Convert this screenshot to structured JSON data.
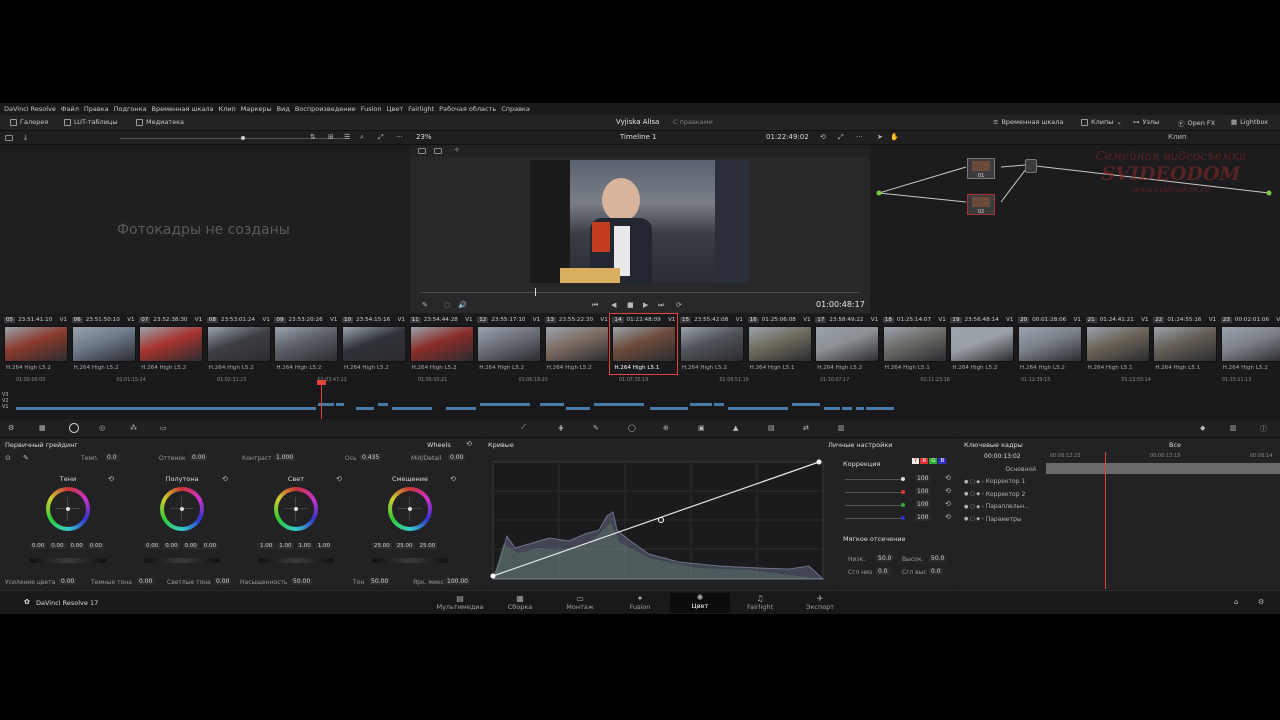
{
  "menu": [
    "DaVinci Resolve",
    "Файл",
    "Правка",
    "Подгонка",
    "Временная шкала",
    "Клип",
    "Маркеры",
    "Вид",
    "Воспроизведение",
    "Fusion",
    "Цвет",
    "Fairlight",
    "Рабочая область",
    "Справка"
  ],
  "toolbar": {
    "gallery": "Галерея",
    "luts": "LUT-таблицы",
    "media": "Медиатека",
    "project_title": "Vyjiska Alisa",
    "project_status": "С правками",
    "timeline_btn": "Временная шкала",
    "clips_btn": "Клипы",
    "nodes_btn": "Узлы",
    "openfx": "Open FX",
    "lightbox": "Lightbox"
  },
  "viewer": {
    "zoom": "23%",
    "timeline_name": "Timeline 1",
    "timecode_top": "01:22:49:02",
    "timecode": "01:00:48:17",
    "clip_mode": "Клип"
  },
  "gallery": {
    "empty_text": "Фотокадры не созданы"
  },
  "nodes": {
    "node1_label": "01",
    "node2_label": "02",
    "watermark_line1": "Семейная видеосъемка",
    "watermark_line2": "SVIDEODOM",
    "watermark_url": "www.svideodom.ru"
  },
  "clips": [
    {
      "num": "05",
      "tc": "23:51:41:10",
      "track": "V1",
      "codec": "H.264 High L5.2",
      "color": "#8a3a2c"
    },
    {
      "num": "06",
      "tc": "23:51:50:10",
      "track": "V1",
      "codec": "H.264 High L5.2",
      "color": "#6c7788"
    },
    {
      "num": "07",
      "tc": "23:52:38:30",
      "track": "V1",
      "codec": "H.264 High L5.2",
      "color": "#a7342e"
    },
    {
      "num": "08",
      "tc": "23:53:01:24",
      "track": "V1",
      "codec": "H.264 High L5.2",
      "color": "#3d3f44"
    },
    {
      "num": "09",
      "tc": "23:53:20:26",
      "track": "V1",
      "codec": "H.264 High L5.2",
      "color": "#5b5f66"
    },
    {
      "num": "10",
      "tc": "23:54:15:16",
      "track": "V1",
      "codec": "H.264 High L5.2",
      "color": "#2f3238"
    },
    {
      "num": "11",
      "tc": "23:54:44:28",
      "track": "V1",
      "codec": "H.264 High L5.2",
      "color": "#8a2d28"
    },
    {
      "num": "12",
      "tc": "23:55:17:10",
      "track": "V1",
      "codec": "H.264 High L5.2",
      "color": "#6b6f78"
    },
    {
      "num": "13",
      "tc": "23:55:22:30",
      "track": "V1",
      "codec": "H.264 High L5.2",
      "color": "#7d6c62"
    },
    {
      "num": "14",
      "tc": "01:22:48:09",
      "track": "V1",
      "codec": "H.264 High L5.1",
      "color": "#6c4a3a"
    },
    {
      "num": "15",
      "tc": "23:55:42:08",
      "track": "V1",
      "codec": "H.264 High L5.2",
      "color": "#4f5258"
    },
    {
      "num": "16",
      "tc": "01:25:06:08",
      "track": "V1",
      "codec": "H.264 High L5.1",
      "color": "#6e6a5c"
    },
    {
      "num": "17",
      "tc": "23:58:49:22",
      "track": "V1",
      "codec": "H.264 High L5.2",
      "color": "#8c8f93"
    },
    {
      "num": "18",
      "tc": "01:25:14:07",
      "track": "V1",
      "codec": "H.264 High L5.1",
      "color": "#6b6a66"
    },
    {
      "num": "19",
      "tc": "23:56:48:14",
      "track": "V1",
      "codec": "H.264 High L5.2",
      "color": "#9aa0a6"
    },
    {
      "num": "20",
      "tc": "00:01:28:06",
      "track": "V1",
      "codec": "H.264 High L5.2",
      "color": "#7a8088"
    },
    {
      "num": "21",
      "tc": "01:24:41:21",
      "track": "V1",
      "codec": "H.264 High L5.1",
      "color": "#6a6256"
    },
    {
      "num": "22",
      "tc": "01:24:55:16",
      "track": "V1",
      "codec": "H.264 High L5.1",
      "color": "#645e55"
    },
    {
      "num": "23",
      "tc": "00:02:01:06",
      "track": "V1",
      "codec": "H.264 High L5.2",
      "color": "#7d8188"
    }
  ],
  "ruler_ticks": [
    "01:00:00:00",
    "01:01:15:24",
    "01:02:31:23",
    "01:03:47:22",
    "01:05:03:21",
    "01:06:19:20",
    "01:07:35:19",
    "01:08:51:18",
    "01:10:07:17",
    "01:11:23:16",
    "01:12:39:15",
    "01:13:55:14",
    "01:15:11:13"
  ],
  "tracks": [
    "V3",
    "V2",
    "V1"
  ],
  "primary": {
    "title": "Первичный грейдинг",
    "mode": "Wheels",
    "temp_label": "Темп.",
    "temp": "0.0",
    "tint_label": "Оттенок",
    "tint": "0.00",
    "contrast_label": "Контраст",
    "contrast": "1.000",
    "pivot_label": "Ось",
    "pivot": "0.435",
    "middetail_label": "Mid/Detail",
    "middetail": "0.00",
    "wheels": [
      {
        "name": "Тени",
        "values": [
          "0.00",
          "0.00",
          "0.00",
          "0.00"
        ]
      },
      {
        "name": "Полутона",
        "values": [
          "0.00",
          "0.00",
          "0.00",
          "0.00"
        ]
      },
      {
        "name": "Свет",
        "values": [
          "1.00",
          "1.00",
          "1.00",
          "1.00"
        ]
      },
      {
        "name": "Смещение",
        "values": [
          "25.00",
          "25.00",
          "25.00"
        ]
      }
    ],
    "boost_label": "Усиление цвета",
    "boost": "0.00",
    "shadows_label": "Темные тона",
    "shadows": "0.00",
    "highlights_label": "Светлые тона",
    "highlights": "0.00",
    "sat_label": "Насыщенность",
    "sat": "50.00",
    "hue_label": "Тон",
    "hue": "50.00",
    "lummix_label": "Ярк. микс",
    "lummix": "100.00"
  },
  "curves": {
    "title": "Кривые",
    "preset": "Личные настройки"
  },
  "correction": {
    "title": "Коррекция",
    "channels": [
      "Y",
      "R",
      "G",
      "B"
    ],
    "values": [
      "100",
      "100",
      "100",
      "100"
    ],
    "soft_title": "Мягкое отсечение",
    "low_label": "Низк.",
    "low": "50.0",
    "high_label": "Высок.",
    "high": "50.0",
    "ls_label": "Сгл низ",
    "ls": "0.0",
    "hs_label": "Сгл выс",
    "hs": "0.0"
  },
  "keyframes": {
    "title": "Ключевые кадры",
    "filter": "Все",
    "timecode": "00:00:13:02",
    "ticks": [
      "00:00:12:23",
      "00:00:13:15",
      "00:00:14"
    ],
    "rows": [
      "Основной",
      "Корректор 1",
      "Корректор 2",
      "Параллельн...",
      "Параметры"
    ]
  },
  "pages": [
    {
      "label": "Мультимедиа",
      "icon": "▤"
    },
    {
      "label": "Сборка",
      "icon": "▦"
    },
    {
      "label": "Монтаж",
      "icon": "▭"
    },
    {
      "label": "Fusion",
      "icon": "✦"
    },
    {
      "label": "Цвет",
      "icon": "✺",
      "active": true
    },
    {
      "label": "Fairlight",
      "icon": "♫"
    },
    {
      "label": "Экспорт",
      "icon": "✈"
    }
  ],
  "app_name": "DaVinci Resolve 17",
  "colors": {
    "accent": "#e2433a",
    "playhead": "#e2433a",
    "track_clip": "#4a7aa6"
  }
}
